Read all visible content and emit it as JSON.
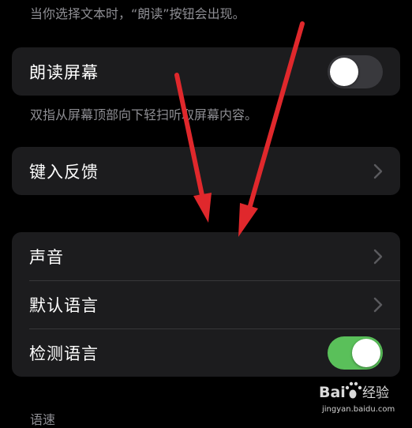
{
  "top_note": "当你选择文本时，“朗读”按钮会出现。",
  "speak_screen": {
    "label": "朗读屏幕",
    "enabled": false,
    "footnote": "双指从屏幕顶部向下轻扫听取屏幕内容。"
  },
  "typing_feedback": {
    "label": "键入反馈"
  },
  "voice_group": {
    "items": [
      {
        "label": "声音"
      },
      {
        "label": "默认语言"
      },
      {
        "label": "检测语言",
        "enabled": true
      }
    ]
  },
  "section_label": "语速",
  "watermark": {
    "brand": "Baidu经验",
    "url": "jingyan.baidu.com"
  },
  "colors": {
    "background": "#000000",
    "cell": "#1c1c1e",
    "toggle_on": "#5ac05a",
    "toggle_off": "#39393d",
    "annotation_arrow": "#e0282c"
  }
}
